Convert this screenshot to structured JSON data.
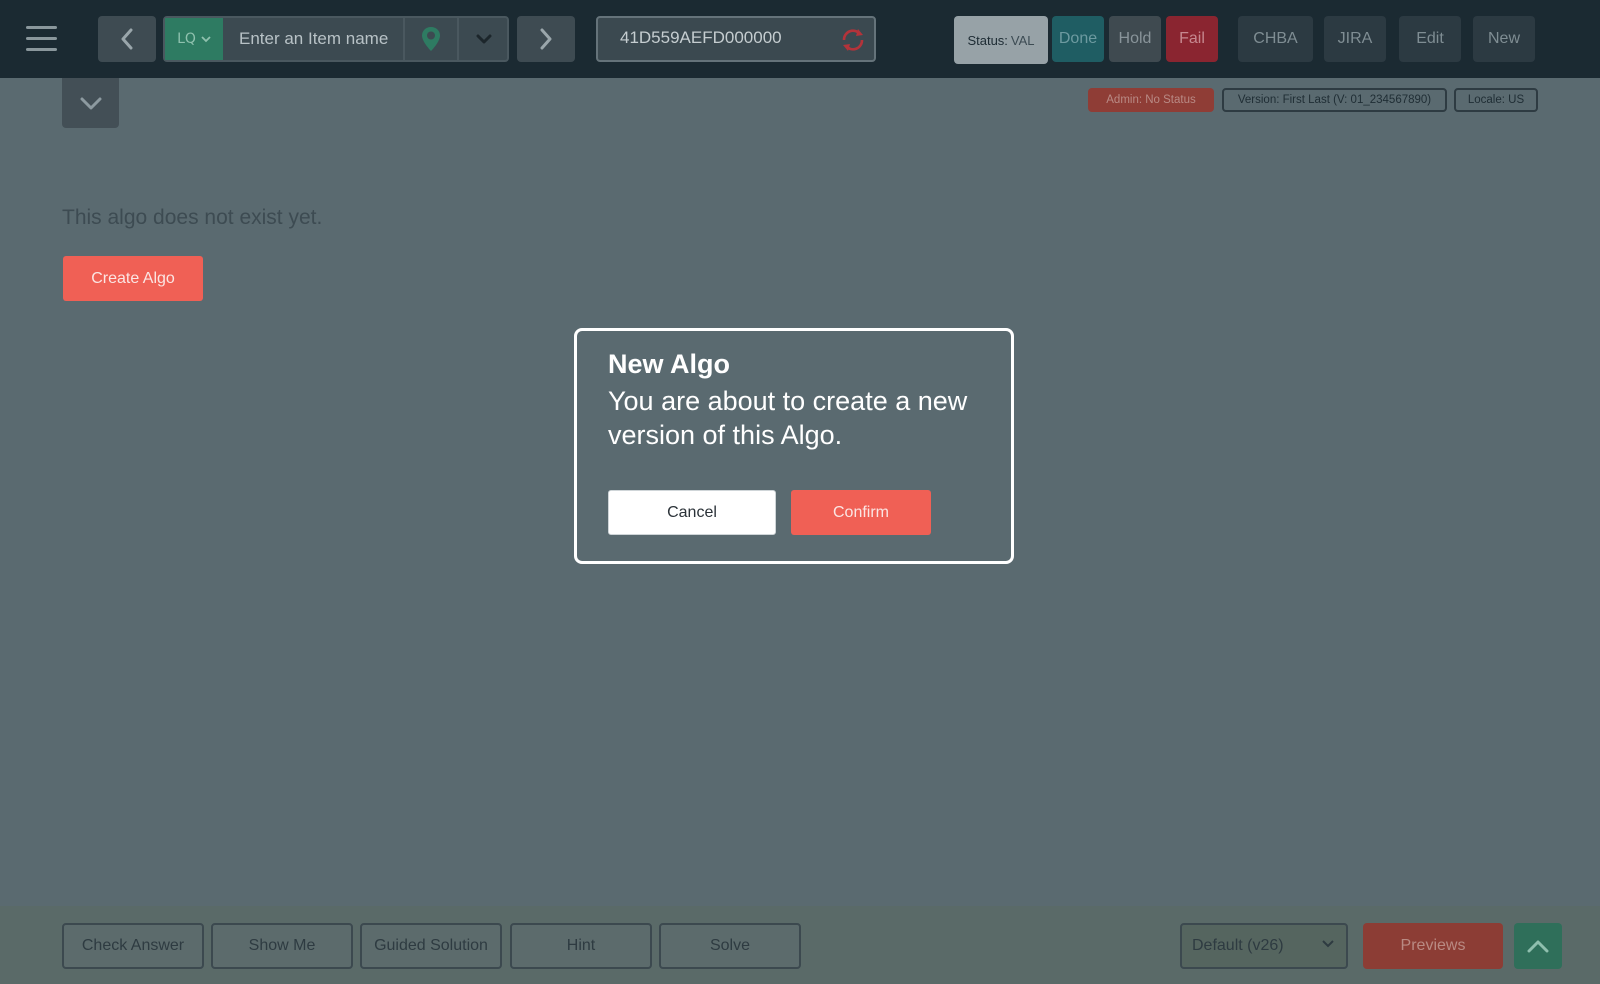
{
  "toolbar": {
    "item_placeholder": "Enter an Item name",
    "lq_label": "LQ",
    "item_id": "41D559AEFD000000",
    "status_label": "Status:",
    "status_value": "VAL",
    "buttons": {
      "done": "Done",
      "hold": "Hold",
      "fail": "Fail",
      "chba": "CHBA",
      "jira": "JIRA",
      "edit": "Edit",
      "new": "New"
    }
  },
  "subbar": {
    "admin": "Admin: No Status",
    "version": "Version: First Last (V: 01_234567890)",
    "locale": "Locale: US"
  },
  "main": {
    "empty_message": "This algo does not exist yet.",
    "create_label": "Create Algo"
  },
  "modal": {
    "title": "New Algo",
    "body": "You are about to create a new version of this Algo.",
    "cancel_label": "Cancel",
    "confirm_label": "Confirm"
  },
  "footer": {
    "check_answer": "Check Answer",
    "show_me": "Show Me",
    "guided_solution": "Guided Solution",
    "hint": "Hint",
    "solve": "Solve",
    "default_select": "Default (v26)",
    "previews": "Previews"
  },
  "colors": {
    "accent": "#f06055",
    "topbar": "#1b2a32",
    "overlay_bg": "#5a6a70",
    "done": "#1f5d63",
    "fail": "#8a2530"
  }
}
